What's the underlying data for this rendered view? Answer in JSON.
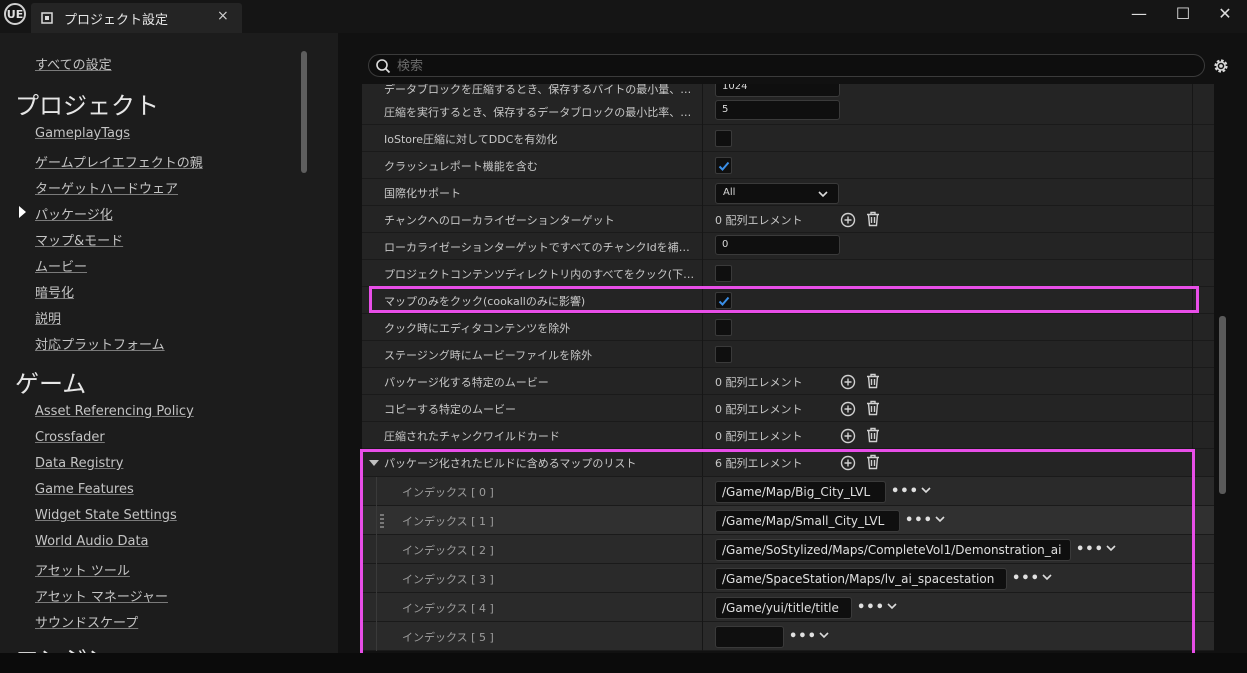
{
  "window": {
    "app_logo": "UE",
    "tab_title": "プロジェクト設定",
    "tab_close": "×",
    "minimize": "—",
    "maximize": "☐",
    "close": "✕"
  },
  "sidebar": {
    "all_settings": "すべての設定",
    "project_header": "プロジェクト",
    "project_items": [
      "GameplayTags",
      "ゲームプレイエフェクトの親",
      "ターゲットハードウェア",
      "パッケージ化",
      "マップ&モード",
      "ムービー",
      "暗号化",
      "説明",
      "対応プラットフォーム"
    ],
    "game_header": "ゲーム",
    "game_items": [
      "Asset Referencing Policy",
      "Crossfader",
      "Data Registry",
      "Game Features",
      "Widget State Settings",
      "World Audio Data",
      "アセット ツール",
      "アセット マネージャー",
      "サウンドスケープ"
    ],
    "engine_header": "エンジン"
  },
  "search": {
    "placeholder": "検索"
  },
  "rows": [
    {
      "name": "データブロックを圧縮するとき、保存するバイトの最小量、その他...",
      "value": "1024"
    },
    {
      "name": "圧縮を実行するとき、保存するデータブロックの最小比率、その他...",
      "value": "5"
    },
    {
      "name": "IoStore圧縮に対してDDCを有効化"
    },
    {
      "name": "クラッシュレポート機能を含む"
    },
    {
      "name": "国際化サポート",
      "value": "All"
    },
    {
      "name": "チャンクへのローカライゼーションターゲット",
      "value": "0 配列エレメント"
    },
    {
      "name": "ローカライゼーションターゲットですべてのチャンクIdを補足する",
      "value": "0"
    },
    {
      "name": "プロジェクトコンテンツディレクトリ内のすべてをクック(下のマッ..."
    },
    {
      "name": "マップのみをクック(cookallのみに影響)"
    },
    {
      "name": "クック時にエディタコンテンツを除外"
    },
    {
      "name": "ステージング時にムービーファイルを除外"
    },
    {
      "name": "パッケージ化する特定のムービー",
      "value": "0 配列エレメント"
    },
    {
      "name": "コピーする特定のムービー",
      "value": "0 配列エレメント"
    },
    {
      "name": "圧縮されたチャンクワイルドカード",
      "value": "0 配列エレメント"
    },
    {
      "name": "パッケージ化されたビルドに含めるマップのリスト",
      "value": "6 配列エレメント"
    }
  ],
  "map_list": [
    {
      "label": "インデックス [ 0 ]",
      "path": "/Game/Map/Big_City_LVL"
    },
    {
      "label": "インデックス [ 1 ]",
      "path": "/Game/Map/Small_City_LVL"
    },
    {
      "label": "インデックス [ 2 ]",
      "path": "/Game/SoStylized/Maps/CompleteVol1/Demonstration_ai"
    },
    {
      "label": "インデックス [ 3 ]",
      "path": "/Game/SpaceStation/Maps/lv_ai_spacestation"
    },
    {
      "label": "インデックス [ 4 ]",
      "path": "/Game/yui/title/title"
    },
    {
      "label": "インデックス [ 5 ]",
      "path": ""
    }
  ],
  "browse_dots": "•••"
}
